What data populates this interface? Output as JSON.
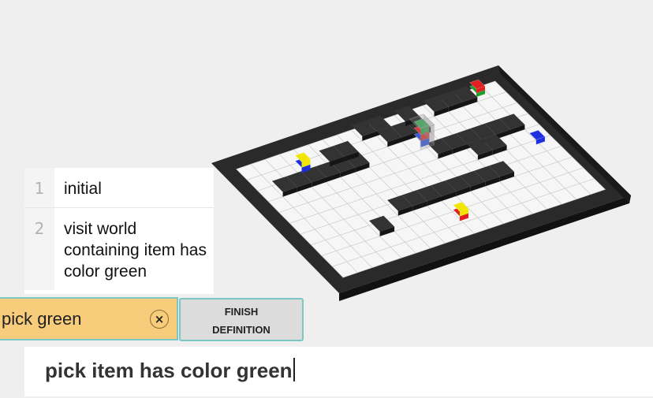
{
  "history": [
    {
      "index": "1",
      "text": "initial"
    },
    {
      "index": "2",
      "text": "visit world containing item has color green"
    }
  ],
  "current_command": {
    "text": "pick green",
    "clear_icon": "×"
  },
  "finish_button": {
    "line1": "FINISH",
    "line2": "DEFINITION"
  },
  "input": {
    "value": "pick item has color green"
  },
  "world": {
    "grid_cols": 20,
    "grid_rows": 12,
    "floor_color": "#f6f6f6",
    "wall_color": "#2a2a2a",
    "grid_line_color": "#c8c8c8",
    "items": [
      {
        "name": "yellow-blue-item",
        "colors": [
          "#f2e600",
          "#1f2fd8"
        ]
      },
      {
        "name": "green-red-flag-item",
        "colors": [
          "#e02020",
          "#1e9e2e"
        ]
      },
      {
        "name": "green-stack-item",
        "colors": [
          "#2ea84a",
          "#d83a3a",
          "#3a5ad8"
        ]
      },
      {
        "name": "blue-cube-item",
        "colors": [
          "#1f2fe0"
        ]
      },
      {
        "name": "yellow-red-item",
        "colors": [
          "#f2e600",
          "#e02020"
        ]
      }
    ]
  }
}
